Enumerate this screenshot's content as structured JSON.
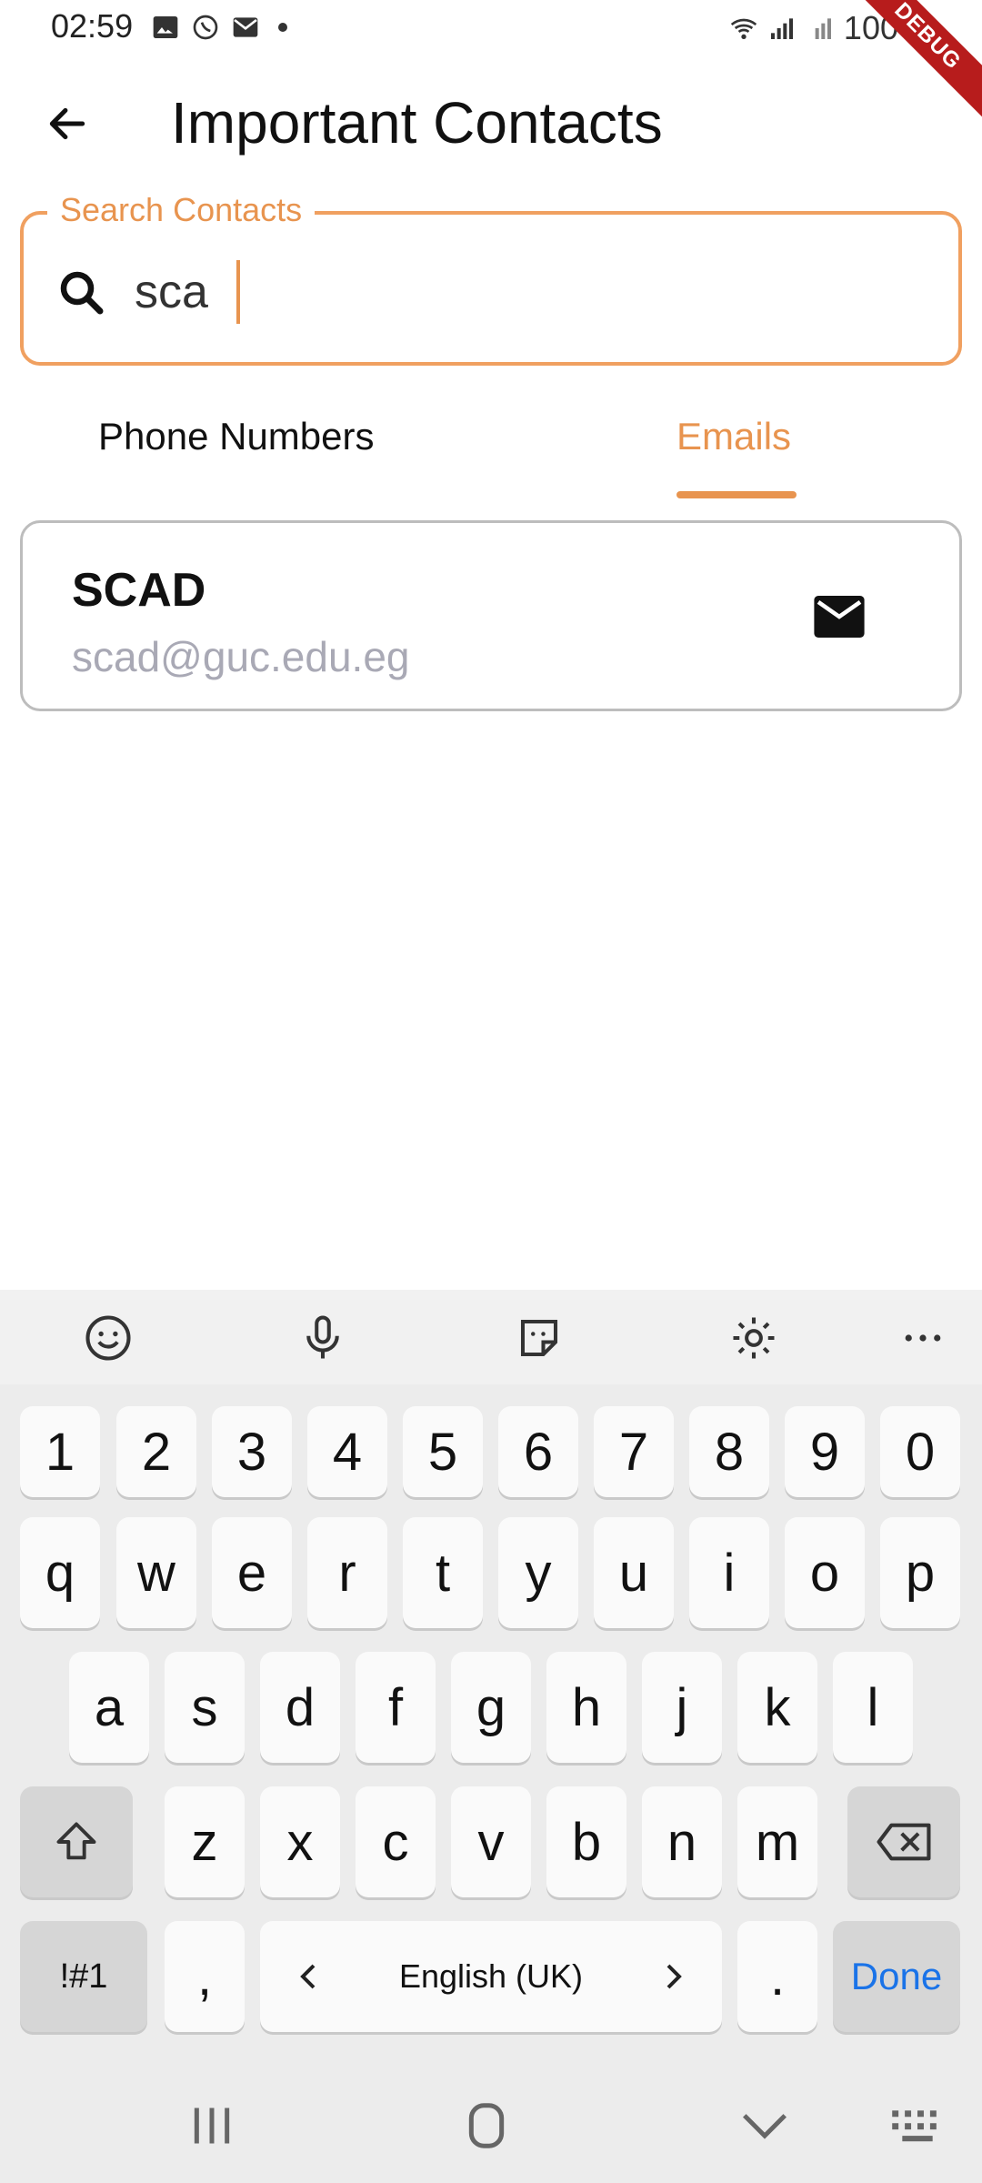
{
  "status_bar": {
    "time": "02:59",
    "battery": "100%",
    "debug_label": "DEBUG"
  },
  "app_bar": {
    "title": "Important Contacts"
  },
  "search": {
    "label": "Search Contacts",
    "value": "sca"
  },
  "tabs": [
    {
      "label": "Phone Numbers"
    },
    {
      "label": "Emails"
    }
  ],
  "selected_tab": "Emails",
  "contacts": [
    {
      "name": "SCAD",
      "email": "scad@guc.edu.eg"
    }
  ],
  "keyboard": {
    "row_numbers": [
      "1",
      "2",
      "3",
      "4",
      "5",
      "6",
      "7",
      "8",
      "9",
      "0"
    ],
    "row_q": [
      "q",
      "w",
      "e",
      "r",
      "t",
      "y",
      "u",
      "i",
      "o",
      "p"
    ],
    "row_a": [
      "a",
      "s",
      "d",
      "f",
      "g",
      "h",
      "j",
      "k",
      "l"
    ],
    "row_z": [
      "z",
      "x",
      "c",
      "v",
      "b",
      "n",
      "m"
    ],
    "symbols_label": "!#1",
    "comma": ",",
    "language": "English (UK)",
    "period": ".",
    "done_label": "Done"
  },
  "colors": {
    "accent": "#E8944F",
    "email_text": "#a9a9b5",
    "done_blue": "#1a73e8"
  }
}
